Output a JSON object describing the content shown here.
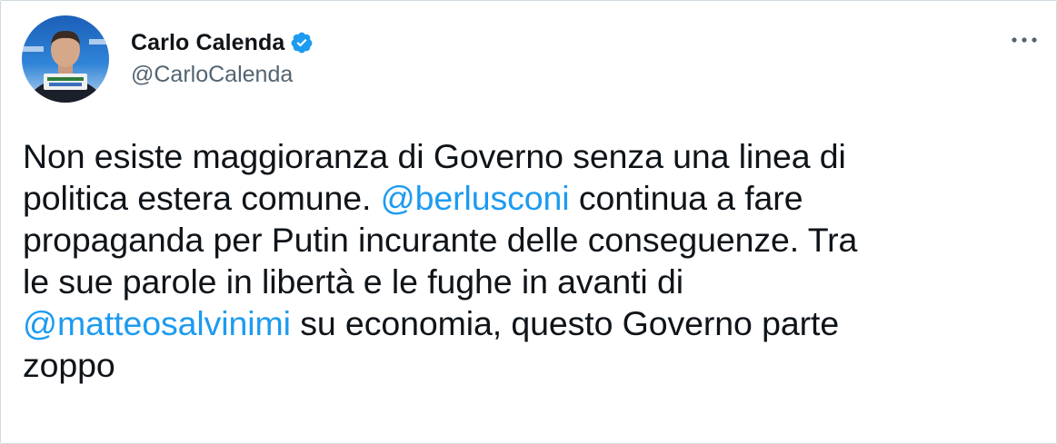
{
  "author": {
    "display_name": "Carlo Calenda",
    "handle": "@CarloCalenda",
    "verified": true,
    "avatar_icon": "user-avatar"
  },
  "menu_icon": "more-horizontal-icon",
  "colors": {
    "text": "#0f1419",
    "secondary": "#536471",
    "link": "#1d9bf0",
    "verified": "#1d9bf0",
    "border": "#cfd9de"
  },
  "tweet": {
    "lines": [
      {
        "parts": [
          {
            "text": "Non esiste maggioranza di Governo senza una linea di",
            "type": "text"
          }
        ]
      },
      {
        "parts": [
          {
            "text": "politica estera comune. ",
            "type": "text"
          },
          {
            "text": "@berlusconi",
            "type": "mention"
          },
          {
            "text": " continua a fare",
            "type": "text"
          }
        ]
      },
      {
        "parts": [
          {
            "text": "propaganda per Putin incurante delle conseguenze. Tra",
            "type": "text"
          }
        ]
      },
      {
        "parts": [
          {
            "text": "le sue parole in libertà e le fughe in avanti di",
            "type": "text"
          }
        ]
      },
      {
        "parts": [
          {
            "text": "@matteosalvinimi",
            "type": "mention"
          },
          {
            "text": " su economia, questo Governo parte",
            "type": "text"
          }
        ]
      },
      {
        "parts": [
          {
            "text": "zoppo",
            "type": "text"
          }
        ]
      }
    ]
  }
}
